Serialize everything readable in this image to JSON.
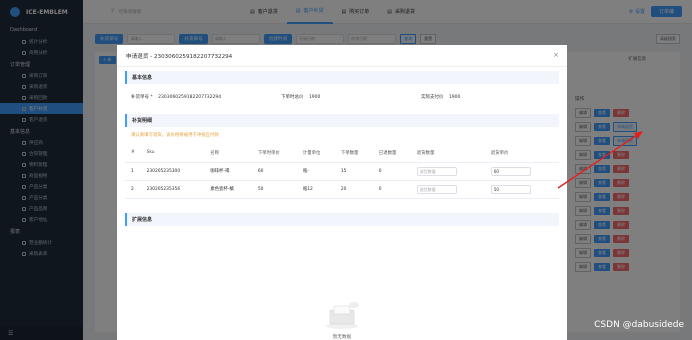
{
  "sidebar": {
    "brand": "ICE-EMBLEM",
    "groups": [
      {
        "label": "Dashboard",
        "items": [
          "统计分析",
          "商用分析"
        ]
      },
      {
        "label": "订单管理",
        "items": [
          "采购订单",
          "采购退货",
          "采购回款",
          "客户补货",
          "客户退货"
        ]
      },
      {
        "label": "基本信息",
        "items": [
          "供应商",
          "合同管理",
          "物料管理",
          "商品规格",
          "产品分类",
          "产品分类",
          "产品品牌",
          "客户地址"
        ]
      },
      {
        "label": "报表",
        "items": [
          "营业额统计",
          "采购表单"
        ]
      }
    ],
    "active_item": "客户补货"
  },
  "topbar": {
    "search_placeholder": "可快速搜索",
    "tabs": [
      "客户退货",
      "客户补货",
      "购买订单",
      "采购退货"
    ],
    "active_tab": "客户补货",
    "settings": "设置",
    "user": "订单编"
  },
  "filters": {
    "labels": [
      "补货单号",
      "补货单号",
      "创建时间"
    ],
    "placeholders": [
      "请输入",
      "请输入",
      "开始日期",
      "结束日期"
    ],
    "search_btn": "查询",
    "reset_btn": "重置",
    "advanced_btn": "高级搜索",
    "expand_info": "扩展信息",
    "add_btn": "+ 新"
  },
  "actions": {
    "header": "操作",
    "edit": "编辑",
    "view": "查看",
    "apply_return": "申请退货",
    "delete": "删除"
  },
  "modal": {
    "title": "申请退货 - 23030602591822077322​94",
    "basic": {
      "header": "基本信息",
      "fields": [
        {
          "label": "补货单号 *",
          "value": "230306025918220773​2294"
        },
        {
          "label": "下单时总价",
          "value": "1900"
        },
        {
          "label": "实际支付价",
          "value": "1900"
        }
      ]
    },
    "detail": {
      "header": "补货明细",
      "warning": "请认真填写退货，该价格将被用于冲抵应付款",
      "columns": [
        "#",
        "Sku",
        "名称",
        "下单时单价",
        "计量单位",
        "下单数量",
        "已退数量",
        "退货数量",
        "退货单价"
      ],
      "rows": [
        {
          "idx": "1",
          "sku": "230205235300",
          "name": "咖啡杯-褐",
          "price": "60",
          "unit": "瓶-",
          "qty": "15",
          "returned": "0",
          "return_qty_ph": "退货数量",
          "return_price": "60"
        },
        {
          "idx": "2",
          "sku": "230205235356",
          "name": "素色瓷杯-橘",
          "price": "50",
          "unit": "瓶12",
          "qty": "20",
          "returned": "0",
          "return_qty_ph": "退货数量",
          "return_price": "50"
        }
      ]
    },
    "ext": {
      "header": "扩展信息",
      "empty": "暂无数据"
    }
  },
  "watermark": "CSDN @dabusidede",
  "colors": {
    "accent": "#409eff",
    "danger": "#f56c6c",
    "sidebar": "#1f2d3d",
    "arrow": "#e02020"
  }
}
